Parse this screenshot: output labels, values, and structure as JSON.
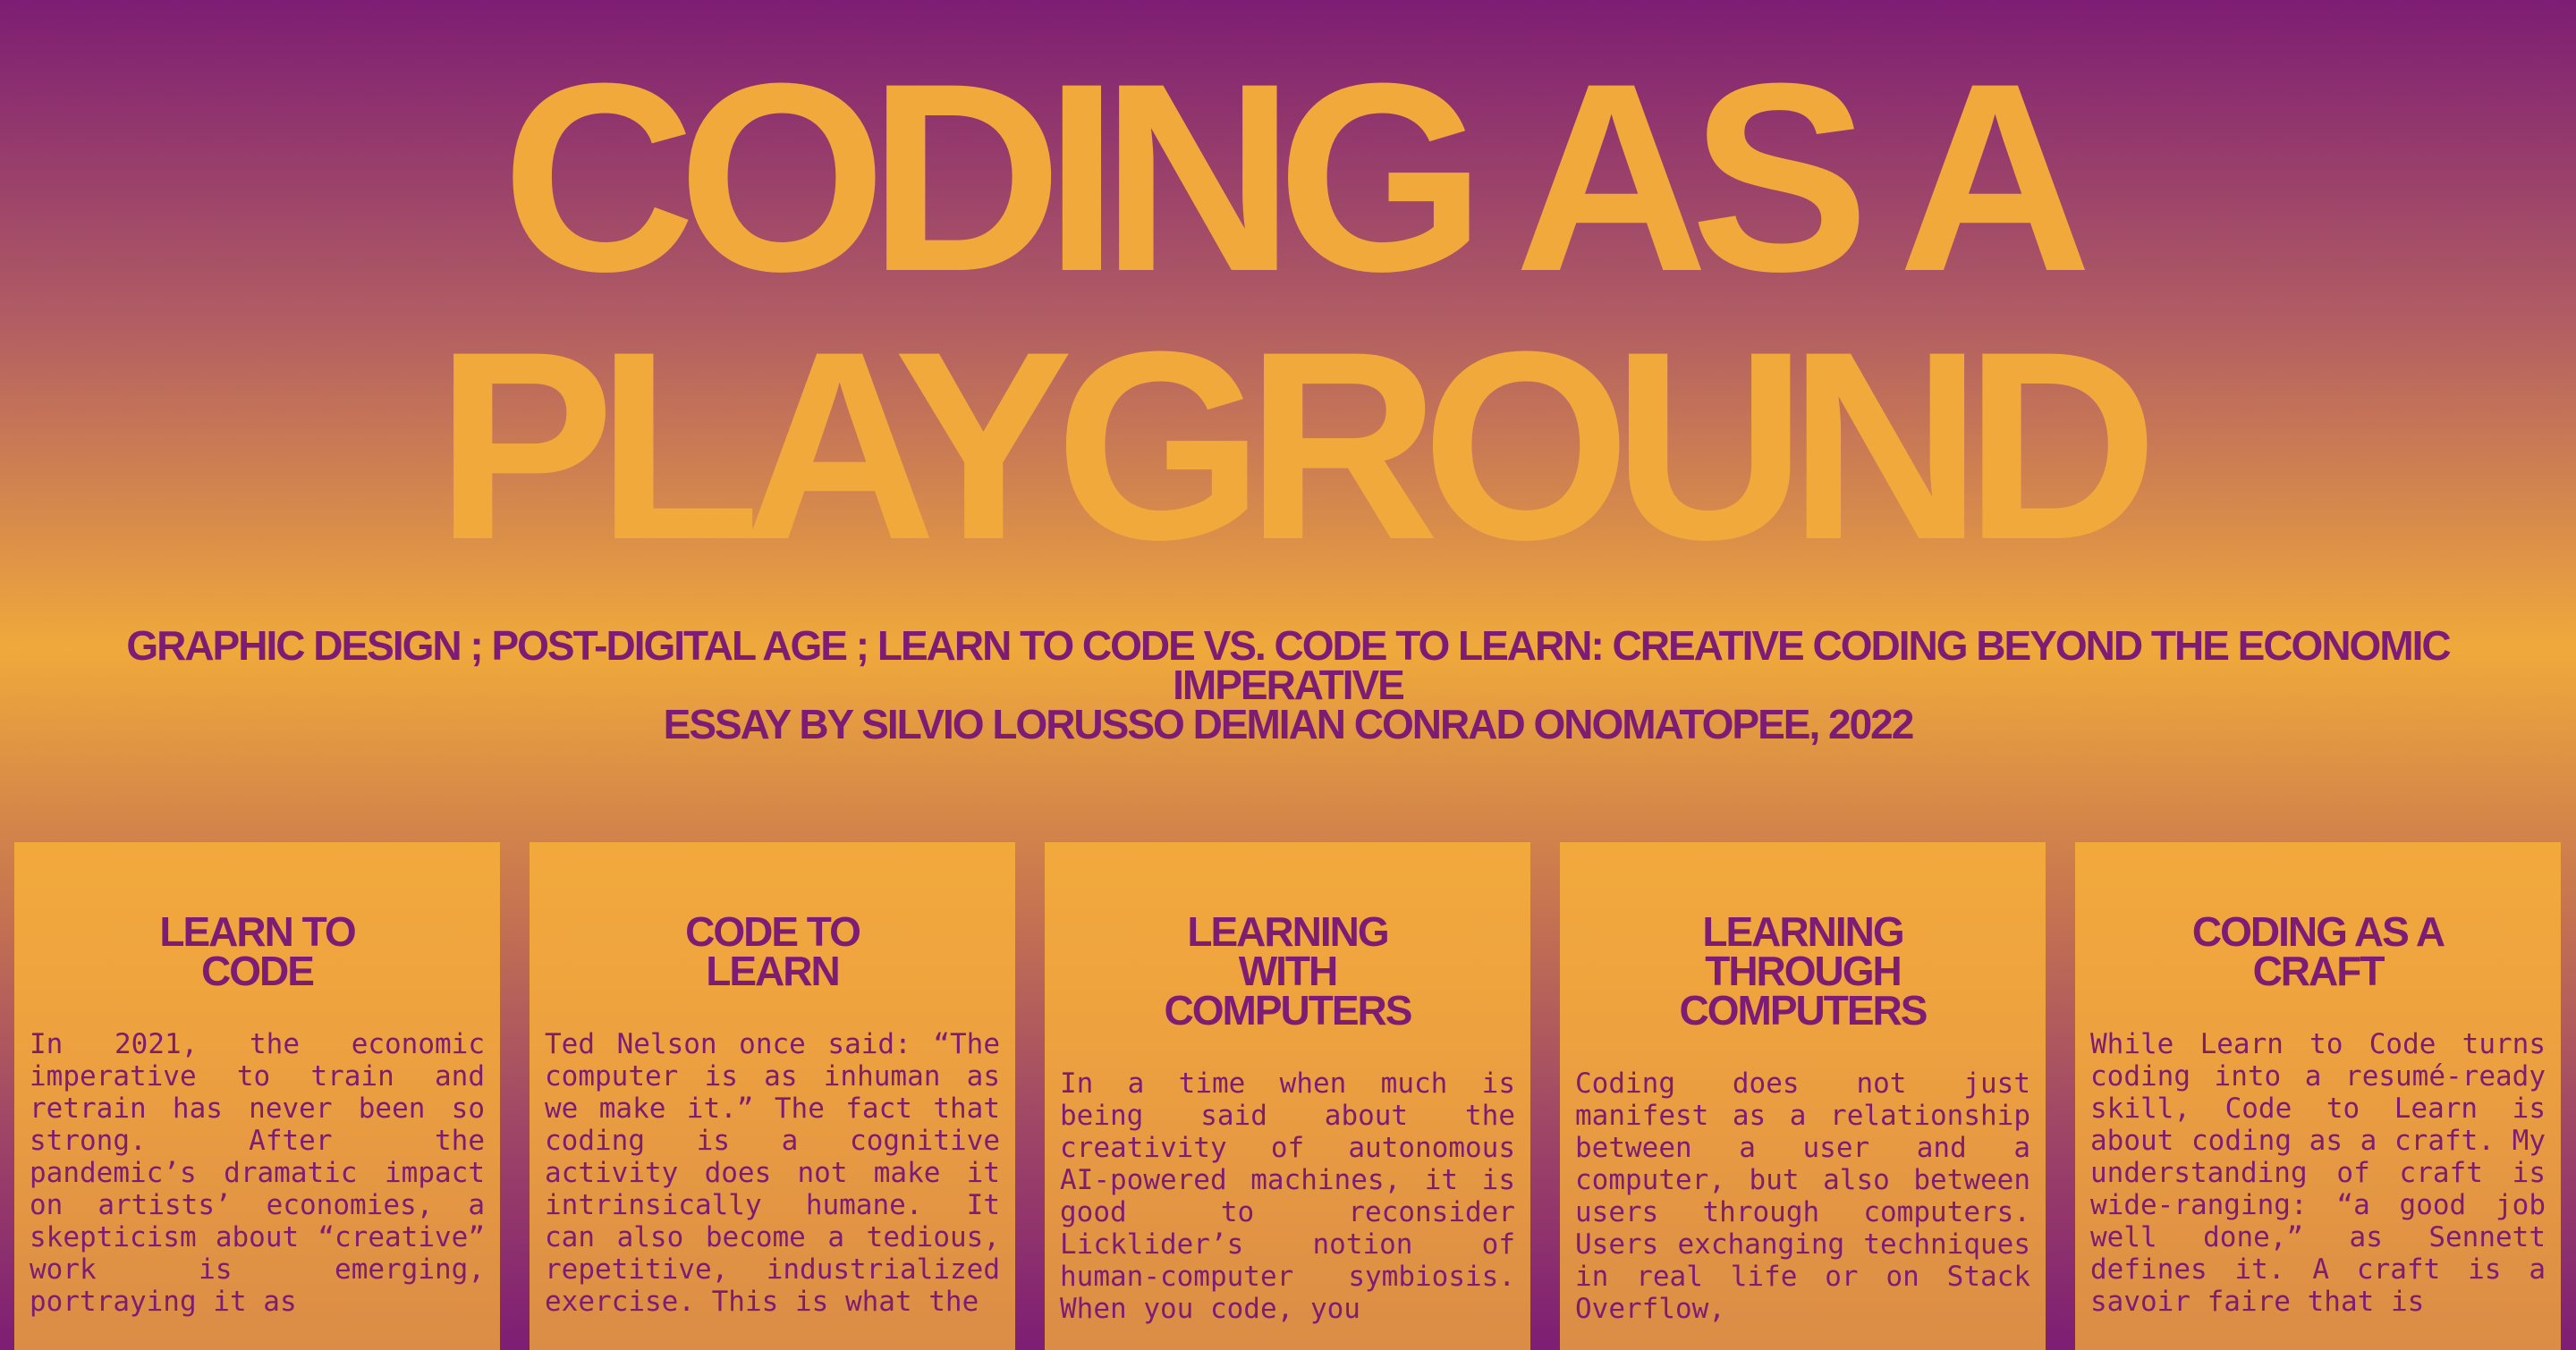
{
  "title": {
    "line1": "CODING AS A",
    "line2": "PLAYGROUND"
  },
  "subtitle": {
    "line1": "GRAPHIC DESIGN ; POST-DIGITAL AGE ; LEARN TO CODE VS. CODE TO LEARN: CREATIVE CODING BEYOND THE ECONOMIC IMPERATIVE",
    "line2": "ESSAY BY SILVIO LORUSSO DEMIAN CONRAD ONOMATOPEE, 2022"
  },
  "columns": [
    {
      "heading_line1": "LEARN TO",
      "heading_line2": "CODE",
      "heading_line3": "",
      "body": "In 2021, the economic imperative to train and retrain has never been so strong. After the pandemic’s dramatic impact on artists’ economies, a skepticism about “creative” work is emerging, portraying it as"
    },
    {
      "heading_line1": "CODE TO",
      "heading_line2": "LEARN",
      "heading_line3": "",
      "body": "Ted Nelson once said: “The computer is as inhuman as we make it.” The fact that coding is a cognitive activity does not make it intrinsically humane. It can also become a tedious, repetitive, industrialized exercise. This is what the"
    },
    {
      "heading_line1": "LEARNING",
      "heading_line2": "WITH",
      "heading_line3": "COMPUTERS",
      "body": "In a time when much is being said about the creativity of autonomous AI-powered machines, it is good to reconsider Licklider’s notion of human-computer symbiosis. When you code, you"
    },
    {
      "heading_line1": "LEARNING",
      "heading_line2": "THROUGH",
      "heading_line3": "COMPUTERS",
      "body": "Coding does not just manifest as a relationship between a user and a computer, but also between users through computers. Users exchanging techniques in real life or on Stack Overflow,"
    },
    {
      "heading_line1": "CODING AS A",
      "heading_line2": "CRAFT",
      "heading_line3": "",
      "body": "While Learn to Code turns coding into a resumé-ready skill, Code to Learn is about coding as a craft. My understanding of craft is wide-ranging: “a good job well done,” as Sennett defines it. A craft is a savoir faire that is"
    }
  ]
}
